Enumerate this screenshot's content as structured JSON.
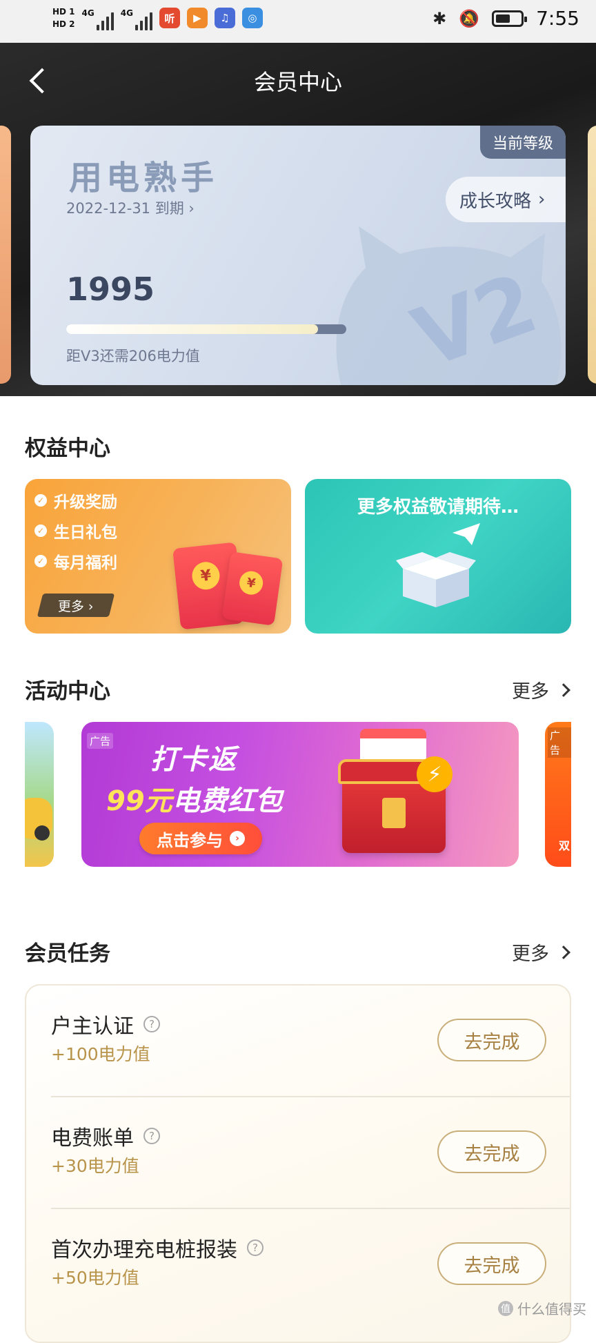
{
  "status_bar": {
    "hd1": "HD 1",
    "hd2": "HD 2",
    "net1": "4G",
    "net2": "4G",
    "app1": "听",
    "time": "7:55"
  },
  "header": {
    "title": "会员中心"
  },
  "level_card": {
    "badge": "当前等级",
    "level_name": "用电熟手",
    "expire": "2022-12-31 到期 ›",
    "growth_button": "成长攻略",
    "points": "1995",
    "progress": 0.9,
    "next_hint": "距V3还需206电力值",
    "mascot_text": "V2"
  },
  "rights": {
    "title": "权益中心",
    "items": [
      "升级奖励",
      "生日礼包",
      "每月福利"
    ],
    "more_label": "更多 ›",
    "coming_soon": "更多权益敬请期待…"
  },
  "activity": {
    "title": "活动中心",
    "more_label": "更多",
    "ad_tag": "广告",
    "banner_line1": "打卡返",
    "banner_line2_a": "99元",
    "banner_line2_b": "电费红包",
    "join_label": "点击参与",
    "right_partial": "双"
  },
  "tasks": {
    "title": "会员任务",
    "more_label": "更多",
    "button_label": "去完成",
    "items": [
      {
        "name": "户主认证",
        "points": "+100电力值"
      },
      {
        "name": "电费账单",
        "points": "+30电力值"
      },
      {
        "name": "首次办理充电桩报装",
        "points": "+50电力值"
      }
    ]
  },
  "watermark": "什么值得买",
  "colors": {
    "accent_gold": "#b8934a",
    "card_orange": "#f9a43a",
    "card_teal": "#2cc5b5",
    "banner_purple": "#b23ad6"
  }
}
